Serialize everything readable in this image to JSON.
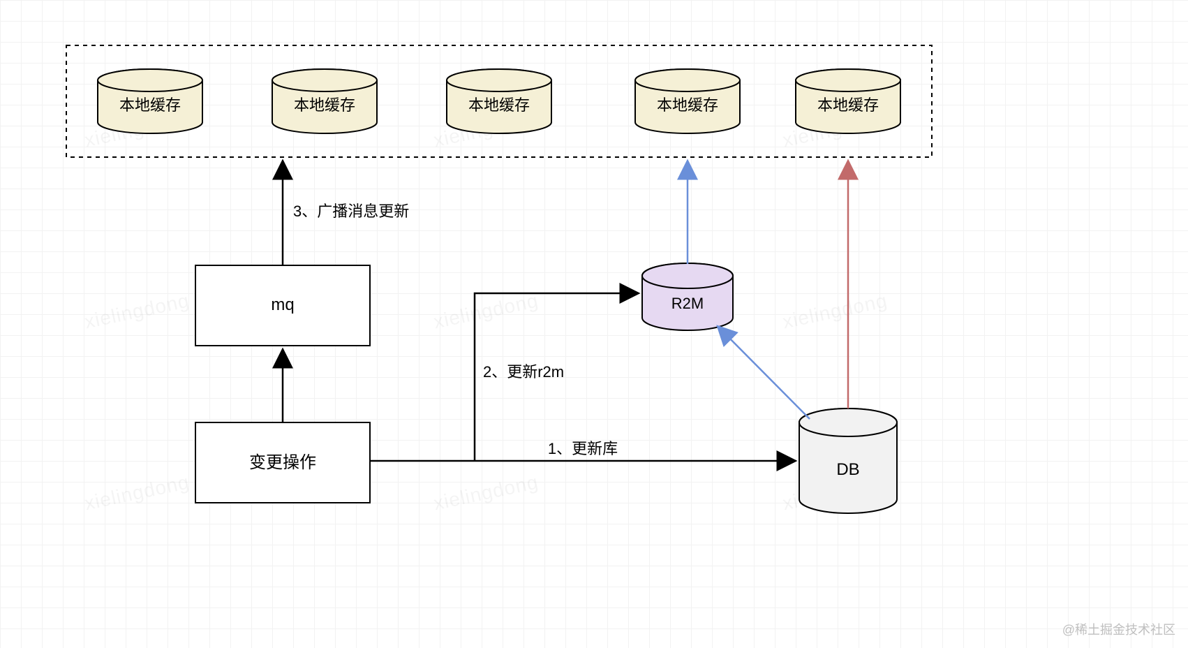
{
  "caches": {
    "label": "本地缓存"
  },
  "mq": {
    "label": "mq"
  },
  "op": {
    "label": "变更操作"
  },
  "r2m": {
    "label": "R2M"
  },
  "db": {
    "label": "DB"
  },
  "edges": {
    "step1": "1、更新库",
    "step2": "2、更新r2m",
    "step3": "3、广播消息更新"
  },
  "colors": {
    "cacheFill": "#f5f0d6",
    "r2mFill": "#e6d9f2",
    "dbFill": "#f2f2f2",
    "stroke": "#000000",
    "blue": "#6a8fd9",
    "red": "#c26a6a"
  },
  "watermark": "xielingdong",
  "credit": "@稀土掘金技术社区"
}
